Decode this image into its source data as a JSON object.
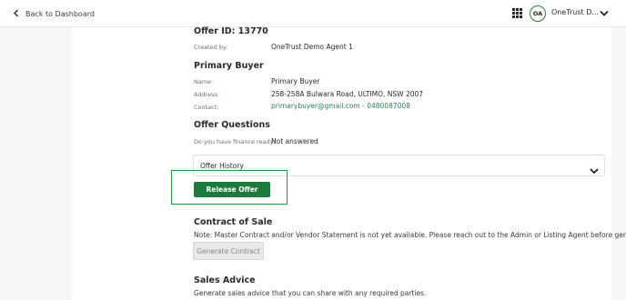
{
  "topbar": {
    "back_label": "Back to Dashboard",
    "avatar_initials": "OA",
    "user_name": "OneTrust D...",
    "icons": [
      "chevron-left-icon",
      "apps-grid-icon",
      "chevron-down-icon"
    ]
  },
  "offer": {
    "title": "Offer ID: 13770",
    "created_by_label": "Created by:",
    "created_by_value": "OneTrust Demo Agent 1"
  },
  "buyer": {
    "heading": "Primary Buyer",
    "name_label": "Name:",
    "name_value": "Primary Buyer",
    "address_label": "Address:",
    "address_value": "258-258A Bulwara Road, ULTIMO, NSW 2007",
    "contact_label": "Contact:",
    "contact_value": "primarybuyer@gmail.com - 0480087008"
  },
  "questions": {
    "heading": "Offer Questions",
    "finance_label": "Do you have finance ready?",
    "finance_value": "Not answered"
  },
  "history": {
    "label": "Offer History"
  },
  "release": {
    "label": "Release Offer"
  },
  "contract": {
    "heading": "Contract of Sale",
    "note": "Note: Master Contract and/or Vendor Statement is not yet available. Please reach out to the Admin or Listing Agent before generating.",
    "button_label": "Generate Contract"
  },
  "advice": {
    "heading": "Sales Advice",
    "note": "Generate sales advice that you can share with any required parties."
  },
  "colors": {
    "accent": "#1c7a3d",
    "highlight_border": "#1a9c3a",
    "link": "#2f7d55"
  }
}
